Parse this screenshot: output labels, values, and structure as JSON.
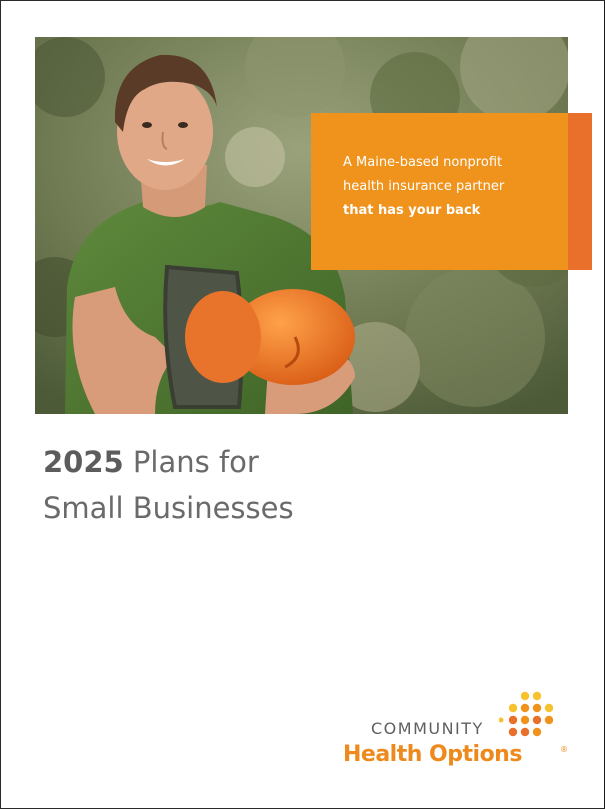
{
  "callout": {
    "line1": "A Maine-based nonprofit",
    "line2": "health insurance partner",
    "line3": "that has your back"
  },
  "title": {
    "year": "2025",
    "line1_rest": " Plans for",
    "line2": "Small Businesses"
  },
  "logo": {
    "line1": "COMMUNITY",
    "line2": "Health Options",
    "reg": "®"
  },
  "colors": {
    "orange": "#f0931c",
    "orange_edge": "#e8702a",
    "yellow": "#f6c22d",
    "title_gray": "#6a6a6a"
  }
}
